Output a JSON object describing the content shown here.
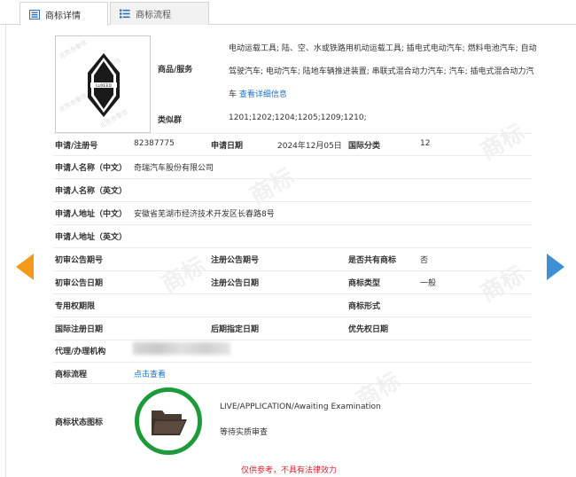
{
  "tabs": [
    {
      "label": "商标详情",
      "active": true,
      "icon": "document-icon"
    },
    {
      "label": "商标流程",
      "active": false,
      "icon": "list-icon"
    }
  ],
  "logo": {
    "text": "LUXEED",
    "watermark": "北京合泰信"
  },
  "goods": {
    "label": "商品/服务",
    "text": "电动运载工具; 陆、空、水或铁路用机动运载工具; 插电式电动汽车; 燃料电池汽车; 自动驾驶汽车; 电动汽车; 陆地车辆推进装置; 串联式混合动力汽车; 汽车; 插电式混合动力汽车",
    "more_link": "查看详细信息"
  },
  "similar_group": {
    "label": "类似群",
    "value": "1201;1202;1204;1205;1209;1210;"
  },
  "reg_no": {
    "label": "申请/注册号",
    "value": "82387775"
  },
  "apply_date": {
    "label": "申请日期",
    "value": "2024年12月05日"
  },
  "intl_class": {
    "label": "国际分类",
    "value": "12"
  },
  "applicant_cn": {
    "label": "申请人名称（中文）",
    "value": "奇瑞汽车股份有限公司"
  },
  "applicant_en": {
    "label": "申请人名称（英文）",
    "value": ""
  },
  "address_cn": {
    "label": "申请人地址（中文）",
    "value": "安徽省芜湖市经济技术开发区长春路8号"
  },
  "address_en": {
    "label": "申请人地址（英文）",
    "value": ""
  },
  "prelim_pub_no": {
    "label": "初审公告期号",
    "value": ""
  },
  "reg_pub_no": {
    "label": "注册公告期号",
    "value": ""
  },
  "shared": {
    "label": "是否共有商标",
    "value": "否"
  },
  "prelim_pub_date": {
    "label": "初审公告日期",
    "value": ""
  },
  "reg_pub_date": {
    "label": "注册公告日期",
    "value": ""
  },
  "tm_type": {
    "label": "商标类型",
    "value": "一般"
  },
  "exclusive_period": {
    "label": "专用权期限",
    "value": ""
  },
  "tm_form": {
    "label": "商标形式",
    "value": ""
  },
  "intl_reg_date": {
    "label": "国际注册日期",
    "value": ""
  },
  "later_designation": {
    "label": "后期指定日期",
    "value": ""
  },
  "priority_date": {
    "label": "优先权日期",
    "value": ""
  },
  "agent": {
    "label": "代理/办理机构",
    "value": ""
  },
  "process": {
    "label": "商标流程",
    "link": "点击查看"
  },
  "status": {
    "label": "商标状态图标",
    "line1": "LIVE/APPLICATION/Awaiting Examination",
    "line2": "等待实质审查",
    "icon": "open-folder-icon"
  },
  "disclaimer": "仅供参考，不具有法律效力",
  "colors": {
    "accent": "#1a73c9",
    "status_ring": "#1e9a3a",
    "prev_arrow": "#f39a1b",
    "next_arrow": "#3d8fd6",
    "disclaimer": "#d9232d"
  }
}
